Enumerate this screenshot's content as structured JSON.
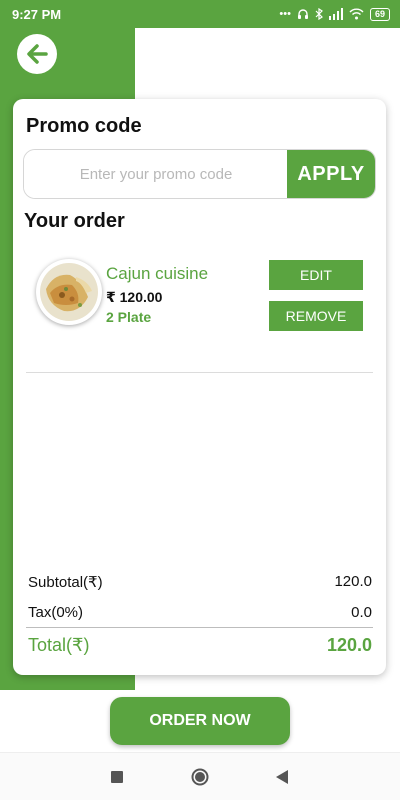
{
  "status_bar": {
    "time": "9:27 PM",
    "icons": "•••",
    "battery": "69"
  },
  "header": {
    "back_icon": "arrow-left-icon"
  },
  "promo": {
    "title": "Promo code",
    "placeholder": "Enter your promo code",
    "value": "",
    "apply_label": "APPLY"
  },
  "order": {
    "title": "Your order",
    "items": [
      {
        "name": "Cajun cuisine",
        "price": "₹ 120.00",
        "quantity": "2 Plate",
        "edit_label": "EDIT",
        "remove_label": "REMOVE"
      }
    ]
  },
  "summary": {
    "subtotal_label": "Subtotal(₹)",
    "subtotal_value": "120.0",
    "tax_label": "Tax(0%)",
    "tax_value": "0.0",
    "total_label": "Total(₹)",
    "total_value": "120.0"
  },
  "footer": {
    "order_now_label": "ORDER NOW"
  },
  "nav": {
    "icons": [
      "recents-square-icon",
      "home-circle-icon",
      "back-triangle-icon"
    ]
  },
  "colors": {
    "accent": "#5aa440",
    "text": "#111111",
    "placeholder": "#b8b8b8"
  }
}
